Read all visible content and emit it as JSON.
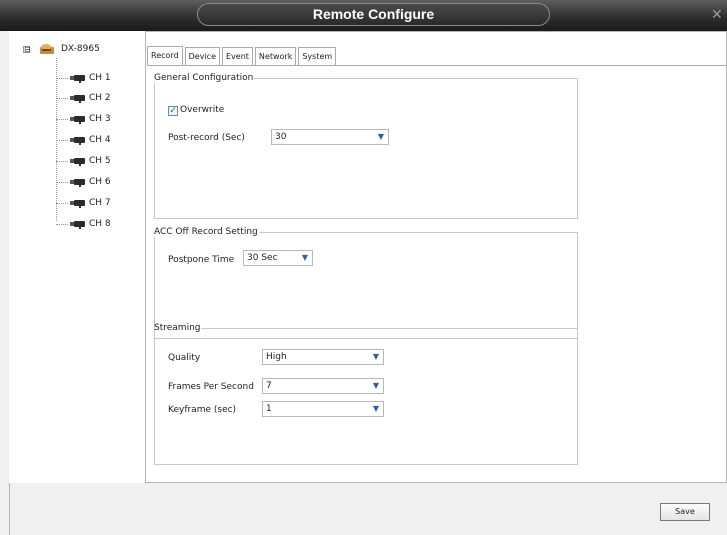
{
  "window": {
    "title": "Remote Configure",
    "close_icon": "close-icon"
  },
  "tree": {
    "root": {
      "label": "DX-8965",
      "expander": "⊟"
    },
    "channels": [
      "CH 1",
      "CH 2",
      "CH 3",
      "CH 4",
      "CH 5",
      "CH 6",
      "CH 7",
      "CH 8"
    ]
  },
  "tabs": [
    "Record",
    "Device",
    "Event",
    "Network",
    "System"
  ],
  "general": {
    "legend": "General Configuration",
    "overwrite_label": "Overwrite",
    "overwrite_checked": true,
    "post_record_label": "Post-record (Sec)",
    "post_record_value": "30"
  },
  "acc": {
    "legend": "ACC Off Record Setting",
    "postpone_label": "Postpone Time",
    "postpone_value": "30 Sec"
  },
  "streaming": {
    "legend": "Streaming",
    "quality_label": "Quality",
    "quality_value": "High",
    "fps_label": "Frames Per Second",
    "fps_value": "7",
    "keyframe_label": "Keyframe (sec)",
    "keyframe_value": "1"
  },
  "footer": {
    "save_label": "Save"
  }
}
